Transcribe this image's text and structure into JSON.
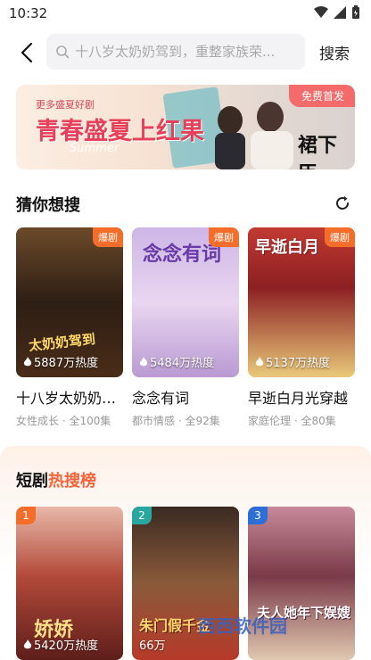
{
  "status": {
    "time": "10:32"
  },
  "header": {
    "search_placeholder": "十八岁太奶奶驾到，重整家族荣...",
    "search_button": "搜索"
  },
  "banner": {
    "subtitle": "更多盛夏好剧",
    "title": "青春盛夏上红果",
    "script": "Summer",
    "badge": "免费首发",
    "show_name": "裙下臣"
  },
  "guess": {
    "title": "猜你想搜",
    "items": [
      {
        "title": "十八岁太奶奶驾到",
        "meta": "女性成长 · 全100集",
        "badge": "爆剧",
        "heat": "5887万热度",
        "art": "太奶奶驾到"
      },
      {
        "title": "念念有词",
        "meta": "都市情感 · 全92集",
        "badge": "爆剧",
        "heat": "5484万热度",
        "art": "念念有词"
      },
      {
        "title": "早逝白月光穿越",
        "meta": "家庭伦理 · 全80集",
        "badge": "爆剧",
        "heat": "5137万热度",
        "art": "早逝白月"
      }
    ]
  },
  "hot": {
    "title_a": "短剧",
    "title_b": "热搜榜",
    "items": [
      {
        "rank": "1",
        "heat": "5420万热度",
        "art": "娇娇"
      },
      {
        "rank": "2",
        "heat": "66万",
        "art": "朱门假千金"
      },
      {
        "rank": "3",
        "heat": "",
        "art": "夫人她年下娱嫂"
      }
    ]
  },
  "watermark": "西西软件园",
  "colors": {
    "accent": "#f4643a",
    "badge": "#f46e2a",
    "rank1": "#f46e2a",
    "rank2": "#27a7a0",
    "rank3": "#2d6fd4"
  }
}
